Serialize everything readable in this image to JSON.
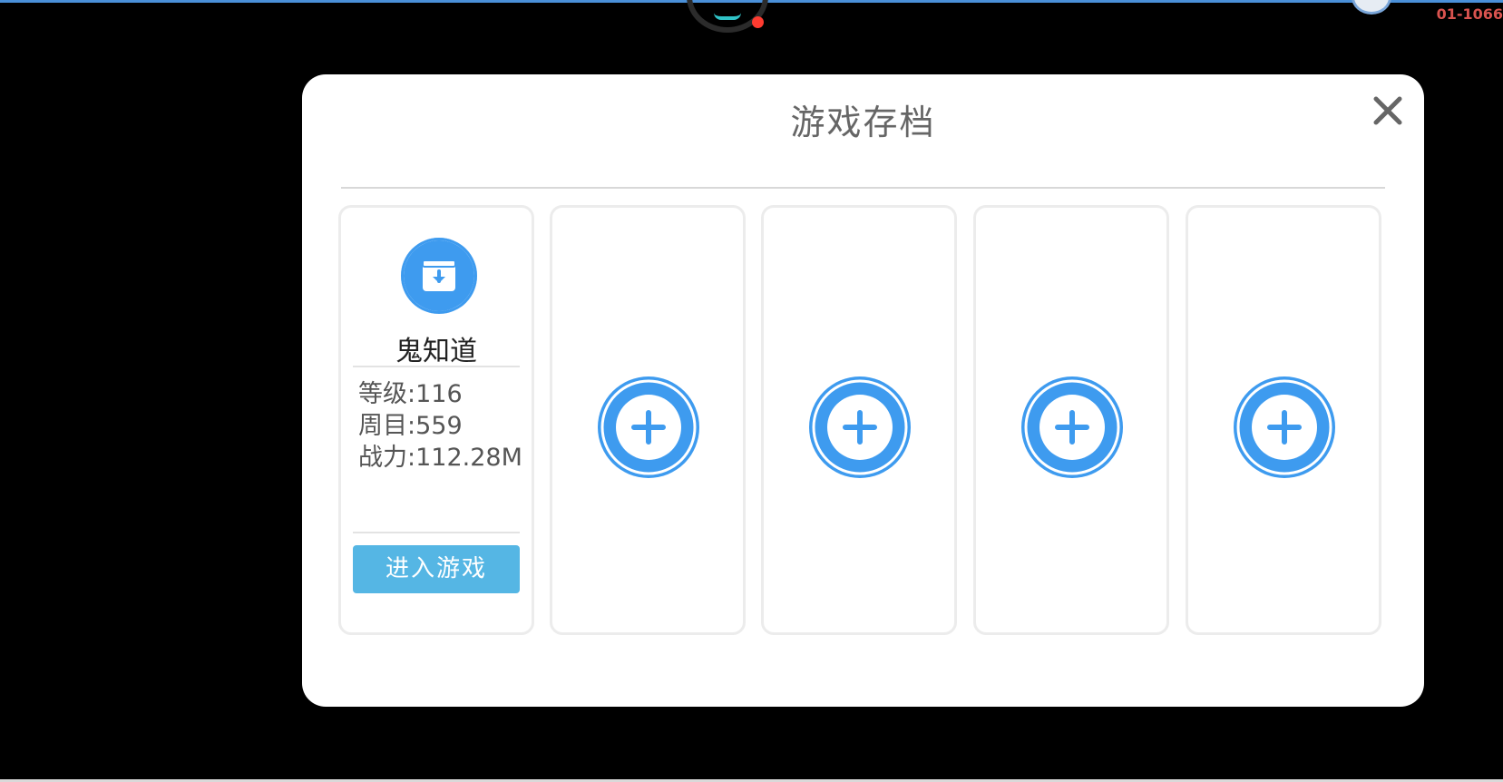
{
  "overlay": {
    "corner_code": "01-1066"
  },
  "dialog": {
    "title": "游戏存档",
    "close_icon": "close-icon",
    "accent_color": "#3e9bef",
    "button_color": "#55b6e4"
  },
  "slots": [
    {
      "filled": true,
      "icon": "save-archive-icon",
      "name": "鬼知道",
      "level_text": "等级:116",
      "round_text": "周目:559",
      "power_text": "战力:112.28M",
      "enter_label": "进入游戏"
    },
    {
      "filled": false,
      "icon": "add-icon"
    },
    {
      "filled": false,
      "icon": "add-icon"
    },
    {
      "filled": false,
      "icon": "add-icon"
    },
    {
      "filled": false,
      "icon": "add-icon"
    }
  ]
}
